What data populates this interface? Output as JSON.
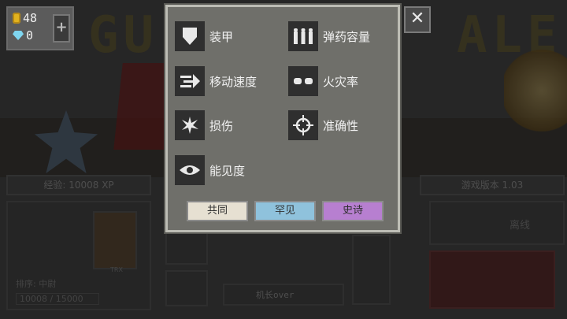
{
  "currency": {
    "coins": "48",
    "gems": "0"
  },
  "dialog": {
    "stats": [
      {
        "label": "装甲",
        "icon": "armor-shield-icon"
      },
      {
        "label": "弹药容量",
        "icon": "ammo-capacity-icon"
      },
      {
        "label": "移动速度",
        "icon": "movement-speed-icon"
      },
      {
        "label": "火灾率",
        "icon": "fire-rate-icon"
      },
      {
        "label": "损伤",
        "icon": "damage-star-icon"
      },
      {
        "label": "准确性",
        "icon": "accuracy-crosshair-icon"
      },
      {
        "label": "能见度",
        "icon": "visibility-eye-icon"
      }
    ],
    "rarity_buttons": [
      {
        "label": "共同",
        "color": "#e6e0d2"
      },
      {
        "label": "罕见",
        "color": "#8fc2dc"
      },
      {
        "label": "史诗",
        "color": "#b77fd0"
      }
    ]
  },
  "background": {
    "experience": "经验: 10008 XP",
    "version": "游戏版本 1.03",
    "rank": "排序: 中尉",
    "progress": "10008 / 15000",
    "offline": "离线",
    "username": "机长over",
    "title_fragment_left": "GU",
    "title_fragment_right": "ALE",
    "trx": "TRX"
  }
}
